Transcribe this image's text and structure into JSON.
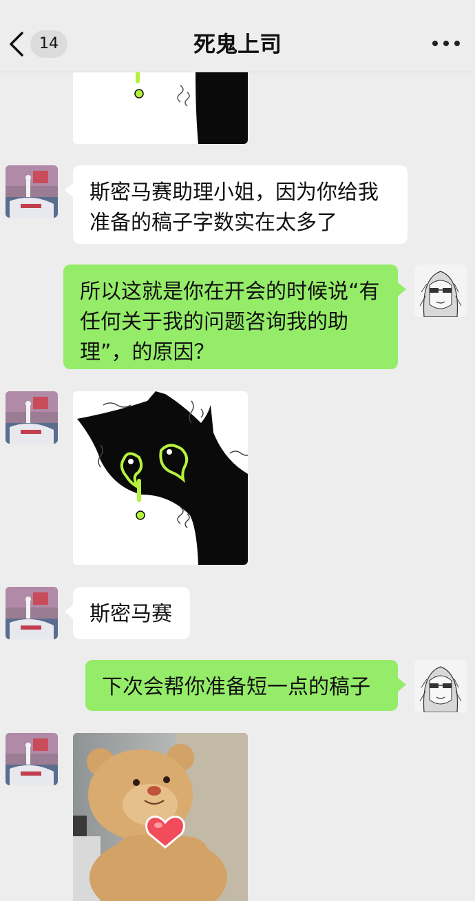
{
  "header": {
    "unread_count": "14",
    "title": "死鬼上司"
  },
  "messages": [
    {
      "sender": "other",
      "type": "sticker",
      "sticker": "crying-black-cat-sticker"
    },
    {
      "sender": "other",
      "type": "text",
      "text": "斯密马赛助理小姐，因为你给我准备的稿子字数实在太多了"
    },
    {
      "sender": "self",
      "type": "text",
      "text": "所以这就是你在开会的时候说“有任何关于我的问题咨询我的助理”，的原因？"
    },
    {
      "sender": "other",
      "type": "sticker",
      "sticker": "crying-black-cat-sticker"
    },
    {
      "sender": "other",
      "type": "text",
      "text": "斯密马赛"
    },
    {
      "sender": "self",
      "type": "text",
      "text": "下次会帮你准备短一点的稿子"
    },
    {
      "sender": "other",
      "type": "sticker",
      "sticker": "teddy-bear-heart-sticker"
    }
  ],
  "colors": {
    "background": "#ededed",
    "incoming_bubble": "#ffffff",
    "outgoing_bubble": "#95ec69",
    "cat_tear": "#b6f23c"
  }
}
